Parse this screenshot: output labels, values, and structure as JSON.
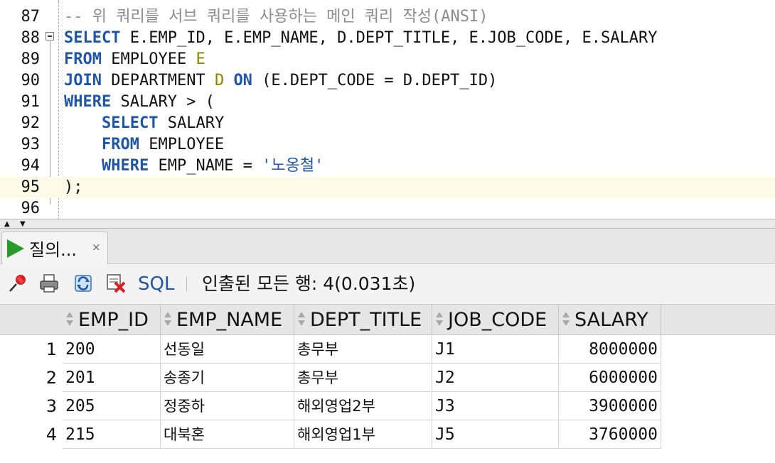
{
  "editor": {
    "lines": [
      {
        "num": "87",
        "segments": [
          {
            "text": "-- 위 쿼리를 서브 쿼리를 사용하는 메인 쿼리 작성(ANSI)",
            "style": "cmt"
          }
        ]
      },
      {
        "num": "88",
        "segments": [
          {
            "text": "SELECT",
            "style": "kw"
          },
          {
            "text": " E.EMP_ID, E.EMP_NAME, D.DEPT_TITLE, E.JOB_CODE, E.SALARY",
            "style": ""
          }
        ]
      },
      {
        "num": "89",
        "segments": [
          {
            "text": "FROM",
            "style": "kw"
          },
          {
            "text": " EMPLOYEE ",
            "style": ""
          },
          {
            "text": "E",
            "style": "alias"
          }
        ]
      },
      {
        "num": "90",
        "segments": [
          {
            "text": "JOIN",
            "style": "kw"
          },
          {
            "text": " DEPARTMENT ",
            "style": ""
          },
          {
            "text": "D",
            "style": "alias"
          },
          {
            "text": " ",
            "style": ""
          },
          {
            "text": "ON",
            "style": "kw"
          },
          {
            "text": " (E.DEPT_CODE = D.DEPT_ID)",
            "style": ""
          }
        ]
      },
      {
        "num": "91",
        "segments": [
          {
            "text": "WHERE",
            "style": "kw"
          },
          {
            "text": " SALARY > (",
            "style": ""
          }
        ]
      },
      {
        "num": "92",
        "segments": [
          {
            "text": "    ",
            "style": ""
          },
          {
            "text": "SELECT",
            "style": "kw"
          },
          {
            "text": " SALARY",
            "style": ""
          }
        ]
      },
      {
        "num": "93",
        "segments": [
          {
            "text": "    ",
            "style": ""
          },
          {
            "text": "FROM",
            "style": "kw"
          },
          {
            "text": " EMPLOYEE",
            "style": ""
          }
        ]
      },
      {
        "num": "94",
        "segments": [
          {
            "text": "    ",
            "style": ""
          },
          {
            "text": "WHERE",
            "style": "kw"
          },
          {
            "text": " EMP_NAME = ",
            "style": ""
          },
          {
            "text": "'노옹철'",
            "style": "str"
          }
        ]
      },
      {
        "num": "95",
        "segments": [
          {
            "text": ");",
            "style": ""
          }
        ],
        "current": true
      },
      {
        "num": "96",
        "segments": []
      }
    ]
  },
  "results_tab": {
    "label": "질의...",
    "close": "×"
  },
  "toolbar": {
    "sql_label": "SQL",
    "status": "인출된 모든 행: 4(0.031초)",
    "icons": [
      "pin-icon",
      "print-icon",
      "refresh-icon",
      "delete-icon"
    ]
  },
  "grid": {
    "columns": [
      "EMP_ID",
      "EMP_NAME",
      "DEPT_TITLE",
      "JOB_CODE",
      "SALARY"
    ],
    "rows": [
      {
        "n": "1",
        "cells": [
          "200",
          "선동일",
          "총무부",
          "J1",
          "8000000"
        ]
      },
      {
        "n": "2",
        "cells": [
          "201",
          "송종기",
          "총무부",
          "J2",
          "6000000"
        ]
      },
      {
        "n": "3",
        "cells": [
          "205",
          "정중하",
          "해외영업2부",
          "J3",
          "3900000"
        ]
      },
      {
        "n": "4",
        "cells": [
          "215",
          "대북혼",
          "해외영업1부",
          "J5",
          "3760000"
        ]
      }
    ]
  },
  "colors": {
    "keyword": "#1f57a6",
    "alias": "#8a8400",
    "comment": "#8c8c8c",
    "run": "#2a9a2a"
  }
}
